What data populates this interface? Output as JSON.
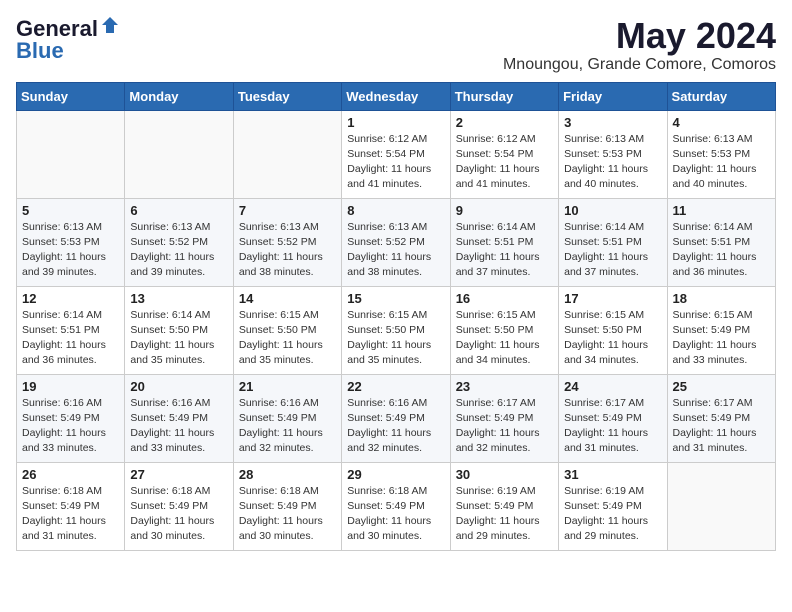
{
  "logo": {
    "general": "General",
    "blue": "Blue"
  },
  "title": {
    "month_year": "May 2024",
    "location": "Mnoungou, Grande Comore, Comoros"
  },
  "weekdays": [
    "Sunday",
    "Monday",
    "Tuesday",
    "Wednesday",
    "Thursday",
    "Friday",
    "Saturday"
  ],
  "weeks": [
    [
      {
        "day": "",
        "info": ""
      },
      {
        "day": "",
        "info": ""
      },
      {
        "day": "",
        "info": ""
      },
      {
        "day": "1",
        "info": "Sunrise: 6:12 AM\nSunset: 5:54 PM\nDaylight: 11 hours\nand 41 minutes."
      },
      {
        "day": "2",
        "info": "Sunrise: 6:12 AM\nSunset: 5:54 PM\nDaylight: 11 hours\nand 41 minutes."
      },
      {
        "day": "3",
        "info": "Sunrise: 6:13 AM\nSunset: 5:53 PM\nDaylight: 11 hours\nand 40 minutes."
      },
      {
        "day": "4",
        "info": "Sunrise: 6:13 AM\nSunset: 5:53 PM\nDaylight: 11 hours\nand 40 minutes."
      }
    ],
    [
      {
        "day": "5",
        "info": "Sunrise: 6:13 AM\nSunset: 5:53 PM\nDaylight: 11 hours\nand 39 minutes."
      },
      {
        "day": "6",
        "info": "Sunrise: 6:13 AM\nSunset: 5:52 PM\nDaylight: 11 hours\nand 39 minutes."
      },
      {
        "day": "7",
        "info": "Sunrise: 6:13 AM\nSunset: 5:52 PM\nDaylight: 11 hours\nand 38 minutes."
      },
      {
        "day": "8",
        "info": "Sunrise: 6:13 AM\nSunset: 5:52 PM\nDaylight: 11 hours\nand 38 minutes."
      },
      {
        "day": "9",
        "info": "Sunrise: 6:14 AM\nSunset: 5:51 PM\nDaylight: 11 hours\nand 37 minutes."
      },
      {
        "day": "10",
        "info": "Sunrise: 6:14 AM\nSunset: 5:51 PM\nDaylight: 11 hours\nand 37 minutes."
      },
      {
        "day": "11",
        "info": "Sunrise: 6:14 AM\nSunset: 5:51 PM\nDaylight: 11 hours\nand 36 minutes."
      }
    ],
    [
      {
        "day": "12",
        "info": "Sunrise: 6:14 AM\nSunset: 5:51 PM\nDaylight: 11 hours\nand 36 minutes."
      },
      {
        "day": "13",
        "info": "Sunrise: 6:14 AM\nSunset: 5:50 PM\nDaylight: 11 hours\nand 35 minutes."
      },
      {
        "day": "14",
        "info": "Sunrise: 6:15 AM\nSunset: 5:50 PM\nDaylight: 11 hours\nand 35 minutes."
      },
      {
        "day": "15",
        "info": "Sunrise: 6:15 AM\nSunset: 5:50 PM\nDaylight: 11 hours\nand 35 minutes."
      },
      {
        "day": "16",
        "info": "Sunrise: 6:15 AM\nSunset: 5:50 PM\nDaylight: 11 hours\nand 34 minutes."
      },
      {
        "day": "17",
        "info": "Sunrise: 6:15 AM\nSunset: 5:50 PM\nDaylight: 11 hours\nand 34 minutes."
      },
      {
        "day": "18",
        "info": "Sunrise: 6:15 AM\nSunset: 5:49 PM\nDaylight: 11 hours\nand 33 minutes."
      }
    ],
    [
      {
        "day": "19",
        "info": "Sunrise: 6:16 AM\nSunset: 5:49 PM\nDaylight: 11 hours\nand 33 minutes."
      },
      {
        "day": "20",
        "info": "Sunrise: 6:16 AM\nSunset: 5:49 PM\nDaylight: 11 hours\nand 33 minutes."
      },
      {
        "day": "21",
        "info": "Sunrise: 6:16 AM\nSunset: 5:49 PM\nDaylight: 11 hours\nand 32 minutes."
      },
      {
        "day": "22",
        "info": "Sunrise: 6:16 AM\nSunset: 5:49 PM\nDaylight: 11 hours\nand 32 minutes."
      },
      {
        "day": "23",
        "info": "Sunrise: 6:17 AM\nSunset: 5:49 PM\nDaylight: 11 hours\nand 32 minutes."
      },
      {
        "day": "24",
        "info": "Sunrise: 6:17 AM\nSunset: 5:49 PM\nDaylight: 11 hours\nand 31 minutes."
      },
      {
        "day": "25",
        "info": "Sunrise: 6:17 AM\nSunset: 5:49 PM\nDaylight: 11 hours\nand 31 minutes."
      }
    ],
    [
      {
        "day": "26",
        "info": "Sunrise: 6:18 AM\nSunset: 5:49 PM\nDaylight: 11 hours\nand 31 minutes."
      },
      {
        "day": "27",
        "info": "Sunrise: 6:18 AM\nSunset: 5:49 PM\nDaylight: 11 hours\nand 30 minutes."
      },
      {
        "day": "28",
        "info": "Sunrise: 6:18 AM\nSunset: 5:49 PM\nDaylight: 11 hours\nand 30 minutes."
      },
      {
        "day": "29",
        "info": "Sunrise: 6:18 AM\nSunset: 5:49 PM\nDaylight: 11 hours\nand 30 minutes."
      },
      {
        "day": "30",
        "info": "Sunrise: 6:19 AM\nSunset: 5:49 PM\nDaylight: 11 hours\nand 29 minutes."
      },
      {
        "day": "31",
        "info": "Sunrise: 6:19 AM\nSunset: 5:49 PM\nDaylight: 11 hours\nand 29 minutes."
      },
      {
        "day": "",
        "info": ""
      }
    ]
  ]
}
